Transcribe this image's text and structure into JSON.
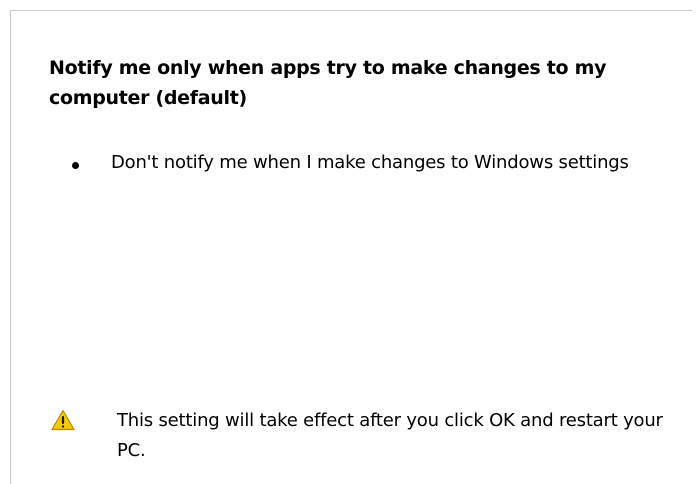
{
  "heading": {
    "text": "Notify me only when apps try to make changes to my computer (default)"
  },
  "bullets": [
    {
      "text": "Don't notify me when I make changes to Windows settings"
    }
  ],
  "warning": {
    "icon": "warning-triangle-icon",
    "icon_color": "#f2c80f",
    "text": "This setting will take effect after you click OK and restart your PC."
  }
}
